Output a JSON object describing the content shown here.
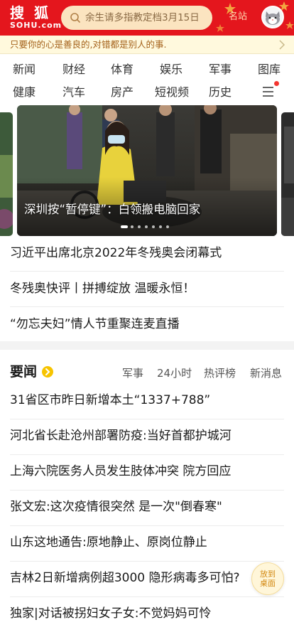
{
  "header": {
    "logo_cn": "搜狐",
    "logo_en": "SOHU.com",
    "search_placeholder": "余生请多指教定档3月15日",
    "famous_label": "名站",
    "brand_color": "#e4161d"
  },
  "slogan": {
    "text": "只要你的心是善良的,对错都是别人的事."
  },
  "nav": {
    "items": [
      "新闻",
      "财经",
      "体育",
      "娱乐",
      "军事",
      "图库",
      "健康",
      "汽车",
      "房产",
      "短视频",
      "历史"
    ],
    "menu_icon": "hamburger-menu-icon"
  },
  "carousel": {
    "caption": "深圳按“暂停键”：白领搬电脑回家",
    "slide_count": 7,
    "active_index": 0
  },
  "headlines": [
    "习近平出席北京2022年冬残奥会闭幕式",
    "冬残奥快评丨拼搏绽放 温暖永恒！",
    "“勿忘夫妇”情人节重聚连麦直播"
  ],
  "section": {
    "title": "要闻",
    "tabs": [
      "军事",
      "24小时",
      "热评榜",
      "新消息"
    ]
  },
  "news": [
    "31省区市昨日新增本土“1337+788”",
    "河北省长赴沧州部署防疫:当好首都护城河",
    "上海六院医务人员发生肢体冲突 院方回应",
    "张文宏:这次疫情很突然 是一次\"倒春寒\"",
    "山东这地通告:原地静止、原岗位静止",
    "吉林2日新增病例超3000 隐形病毒多可怕?",
    "独家|对话被拐妇女子女:不觉妈妈可怜"
  ],
  "float_button": {
    "line1": "放到",
    "line2": "桌面"
  }
}
